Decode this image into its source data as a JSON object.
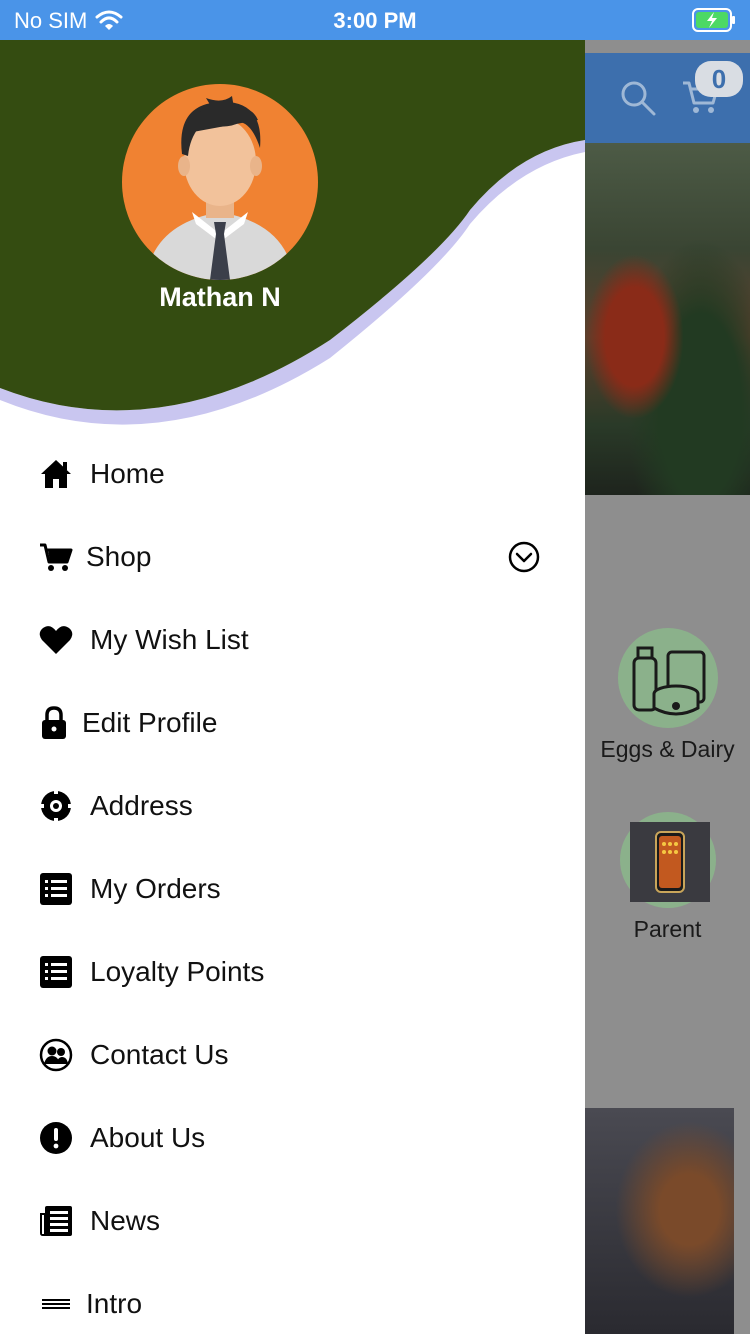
{
  "status_bar": {
    "carrier": "No SIM",
    "time": "3:00 PM"
  },
  "background_app": {
    "cart_count": "0",
    "categories": [
      {
        "label": "Eggs & Dairy",
        "icon": "eggs-dairy-icon"
      },
      {
        "label": "Parent",
        "icon": "phone-thumbnail"
      }
    ]
  },
  "drawer": {
    "user_name": "Mathan N",
    "colors": {
      "header": "#344c11",
      "shadow": "#c9c6f0",
      "avatar_bg": "#f08232"
    },
    "menu": [
      {
        "label": "Home",
        "icon": "home-icon"
      },
      {
        "label": "Shop",
        "icon": "cart-icon",
        "expandable": true
      },
      {
        "label": "My Wish List",
        "icon": "heart-icon"
      },
      {
        "label": "Edit Profile",
        "icon": "lock-icon"
      },
      {
        "label": "Address",
        "icon": "locate-icon"
      },
      {
        "label": "My Orders",
        "icon": "list-icon"
      },
      {
        "label": "Loyalty Points",
        "icon": "list-icon"
      },
      {
        "label": "Contact Us",
        "icon": "contacts-icon"
      },
      {
        "label": "About Us",
        "icon": "info-icon"
      },
      {
        "label": "News",
        "icon": "news-icon"
      },
      {
        "label": "Intro",
        "icon": "menu-lines-icon"
      }
    ]
  }
}
